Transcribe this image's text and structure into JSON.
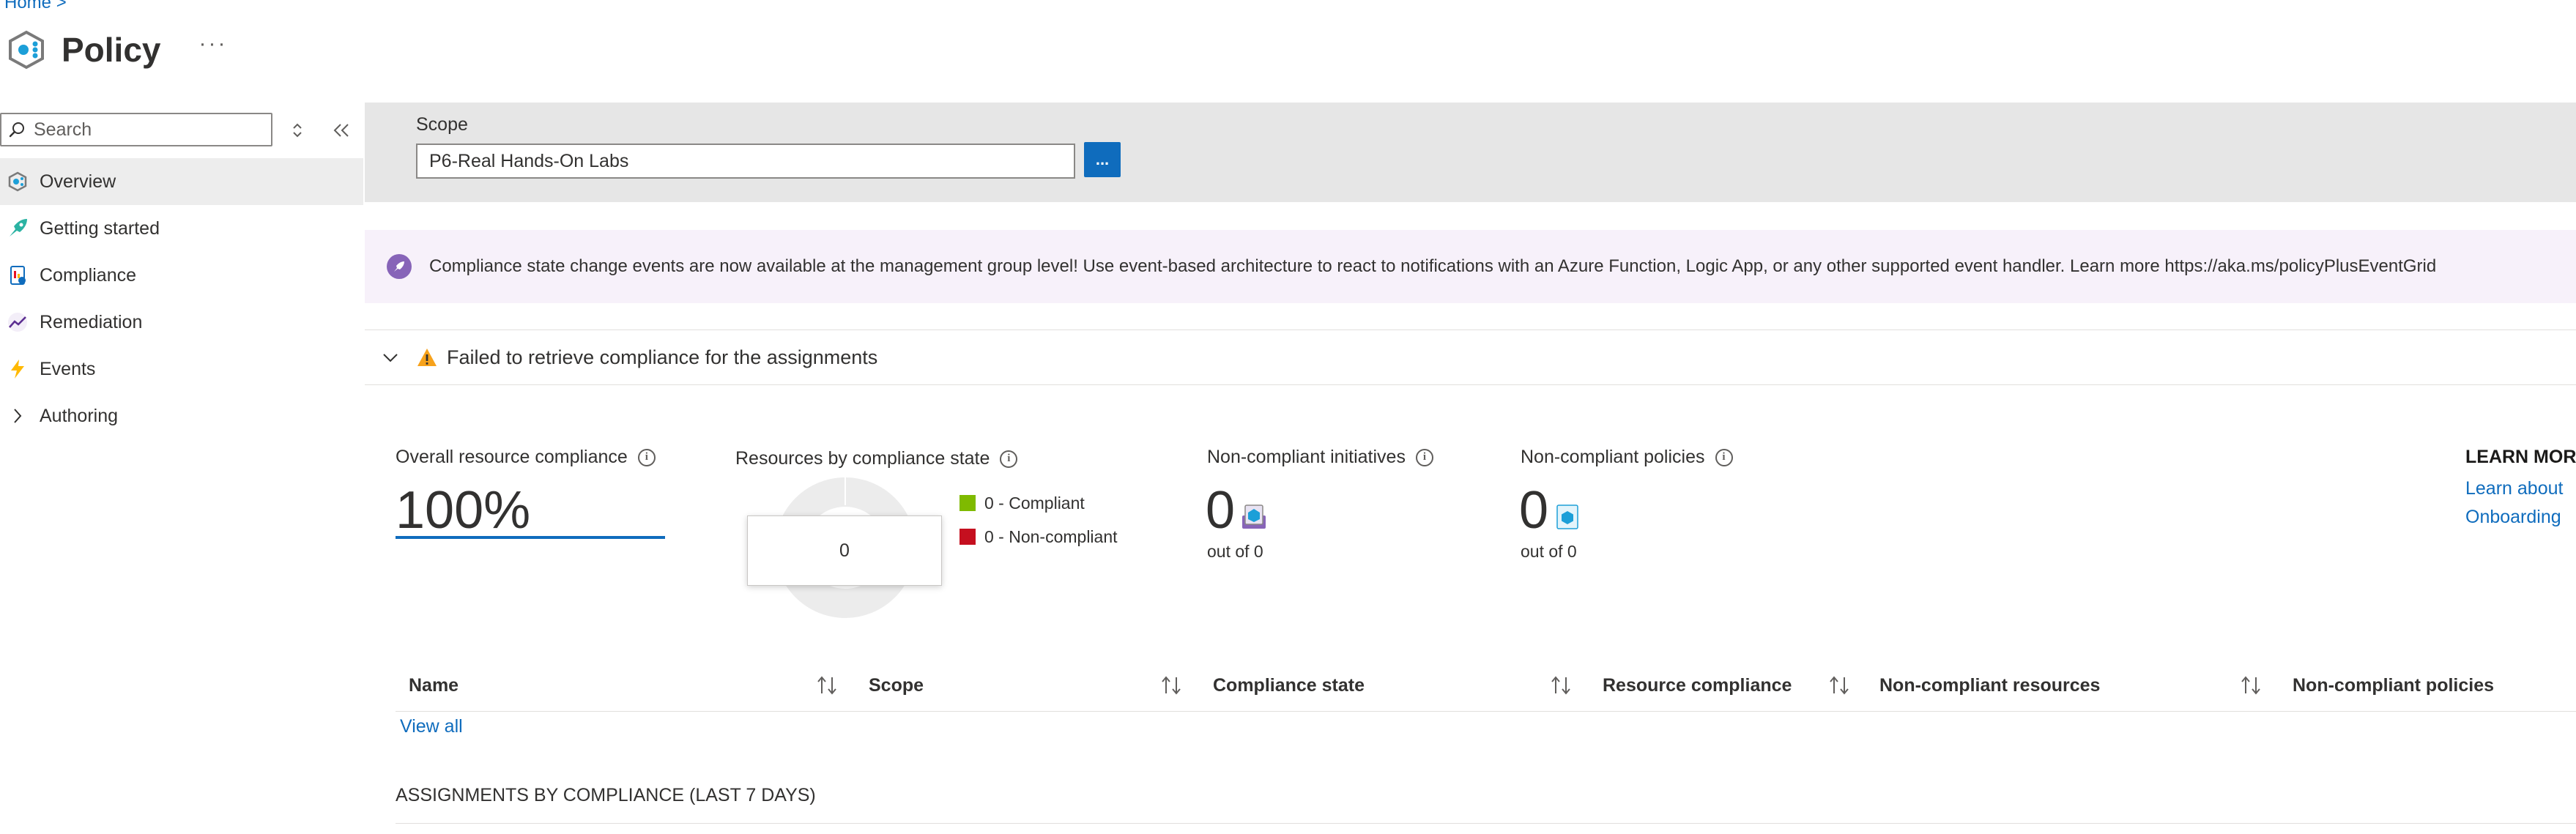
{
  "breadcrumb": {
    "home": "Home",
    "separator": ">"
  },
  "header": {
    "title": "Policy",
    "more_label": "···",
    "icon": "policy-logo-icon"
  },
  "sidebar": {
    "search_placeholder": "Search",
    "items": [
      {
        "label": "Overview",
        "icon": "overview-icon",
        "active": true
      },
      {
        "label": "Getting started",
        "icon": "getting-started-icon",
        "active": false
      },
      {
        "label": "Compliance",
        "icon": "compliance-icon",
        "active": false
      },
      {
        "label": "Remediation",
        "icon": "remediation-icon",
        "active": false
      },
      {
        "label": "Events",
        "icon": "events-icon",
        "active": false
      },
      {
        "label": "Authoring",
        "icon": "chevron-right-icon",
        "active": false
      }
    ]
  },
  "scope": {
    "label": "Scope",
    "value": "P6-Real Hands-On Labs",
    "button_label": "..."
  },
  "banner": {
    "text": "Compliance state change events are now available at the management group level! Use event-based architecture to react to notifications with an Azure Function, Logic App, or any other supported event handler. Learn more https://aka.ms/policyPlusEventGrid"
  },
  "warning": {
    "text": "Failed to retrieve compliance for the assignments"
  },
  "kpis": {
    "overall": {
      "label": "Overall resource compliance",
      "value": "100%"
    },
    "by_state": {
      "label": "Resources by compliance state",
      "tooltip_value": "0",
      "legend": [
        {
          "label": "0 - Compliant",
          "color": "#7fba00"
        },
        {
          "label": "0 - Non-compliant",
          "color": "#c50f1f"
        }
      ]
    },
    "initiatives": {
      "label": "Non-compliant initiatives",
      "value": "0",
      "sub": "out of 0"
    },
    "policies": {
      "label": "Non-compliant policies",
      "value": "0",
      "sub": "out of 0"
    }
  },
  "learn_more": {
    "title": "LEARN MORE",
    "links": [
      "Learn about",
      "Onboarding"
    ]
  },
  "table": {
    "columns": [
      "Name",
      "Scope",
      "Compliance state",
      "Resource compliance",
      "Non-compliant resources",
      "Non-compliant policies"
    ],
    "view_all": "View all"
  },
  "section": {
    "title": "ASSIGNMENTS BY COMPLIANCE (LAST 7 DAYS)"
  },
  "colors": {
    "accent": "#0f6cbd",
    "banner_bg": "#f7f1fa",
    "scope_bg": "#e6e6e6"
  }
}
